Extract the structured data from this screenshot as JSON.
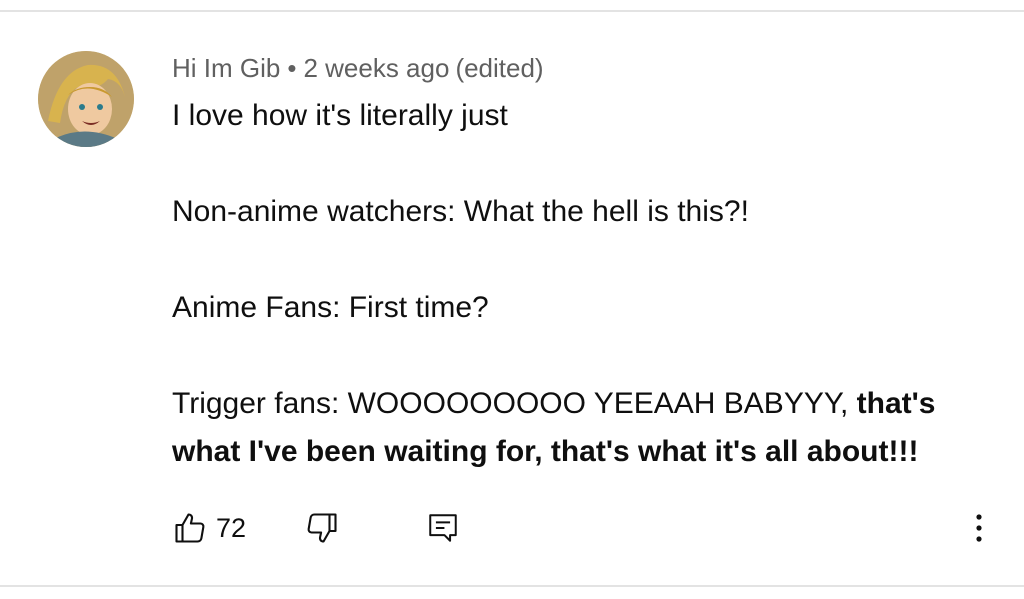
{
  "comment": {
    "author": "Hi Im Gib",
    "separator": "•",
    "time": "2 weeks ago",
    "edited": "(edited)",
    "lines": {
      "l1": "I love how it's literally just",
      "l2": "Non-anime watchers: What the hell is this?!",
      "l3": "Anime Fans: First time?",
      "l4_regular": "Trigger fans: WOOOOOOOOO YEEAAH BABYYY, ",
      "l4_bold": "that's what I've been waiting for, that's what it's all about!!!"
    }
  },
  "actions": {
    "like_count": "72",
    "like_icon": "thumbs-up-icon",
    "dislike_icon": "thumbs-down-icon",
    "reply_icon": "reply-comment-icon",
    "more_icon": "more-vertical-icon"
  },
  "colors": {
    "text": "#0f0f0f",
    "meta": "#606060",
    "divider": "#e3e3e3"
  }
}
